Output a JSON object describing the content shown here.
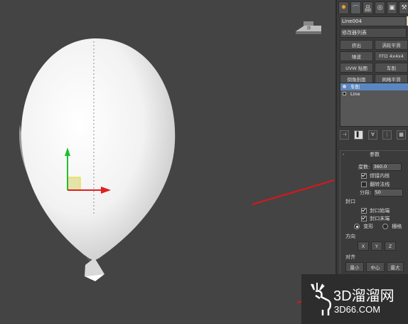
{
  "panel": {
    "tabs": [
      "create-tab",
      "modify-tab",
      "hierarchy-tab",
      "motion-tab",
      "display-tab",
      "utilities-tab"
    ],
    "object_name": "Line004",
    "modifier_list_label": "修改器列表",
    "modifier_buttons": [
      "挤出",
      "涡轮平滑",
      "噪波",
      "FFD 4x4x4",
      "UVW 贴图",
      "车削",
      "倒角剖面",
      "网格平滑"
    ],
    "stack": [
      {
        "label": "车削",
        "selected": true
      },
      {
        "label": "Line",
        "selected": false
      }
    ],
    "params": {
      "title": "参数",
      "degrees_label": "度数:",
      "degrees_value": "360.0",
      "weld_core_label": "焊接内核",
      "weld_core_checked": true,
      "flip_normals_label": "翻转法线",
      "flip_normals_checked": false,
      "segments_label": "分段:",
      "segments_value": "50",
      "cap_title": "封口",
      "cap_start_label": "封口始端",
      "cap_start_checked": true,
      "cap_end_label": "封口末端",
      "cap_end_checked": true,
      "morph_label": "变形",
      "grid_label": "栅格",
      "direction_title": "方向",
      "axes": [
        "X",
        "Y",
        "Z"
      ],
      "align_title": "对齐",
      "align_min": "最小",
      "align_center": "中心",
      "align_max": "最大"
    }
  },
  "watermark": {
    "main": "3D溜溜网",
    "sub": "3D66.COM"
  },
  "colors": {
    "viewport_bg": "#444444",
    "annotation_red": "#e0141b",
    "gizmo_y": "#1fbf2c",
    "gizmo_x": "#e02020",
    "gizmo_pivot": "#e5e044"
  }
}
